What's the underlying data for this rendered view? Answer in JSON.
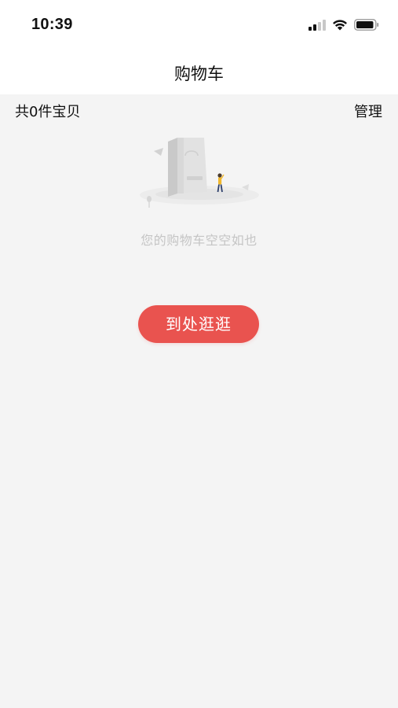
{
  "status_bar": {
    "time": "10:39",
    "icons": [
      "cellular-signal-icon",
      "wifi-icon",
      "battery-icon"
    ]
  },
  "nav": {
    "title": "购物车"
  },
  "cart_header": {
    "item_count_label": "共0件宝贝",
    "manage_label": "管理"
  },
  "empty_state": {
    "illustration": "empty-shopping-bag-illustration",
    "message": "您的购物车空空如也",
    "button_label": "到处逛逛"
  },
  "colors": {
    "page_background": "#f4f4f4",
    "bar_background": "#ffffff",
    "accent": "#e9534f",
    "muted_text": "#c5c5c5"
  }
}
